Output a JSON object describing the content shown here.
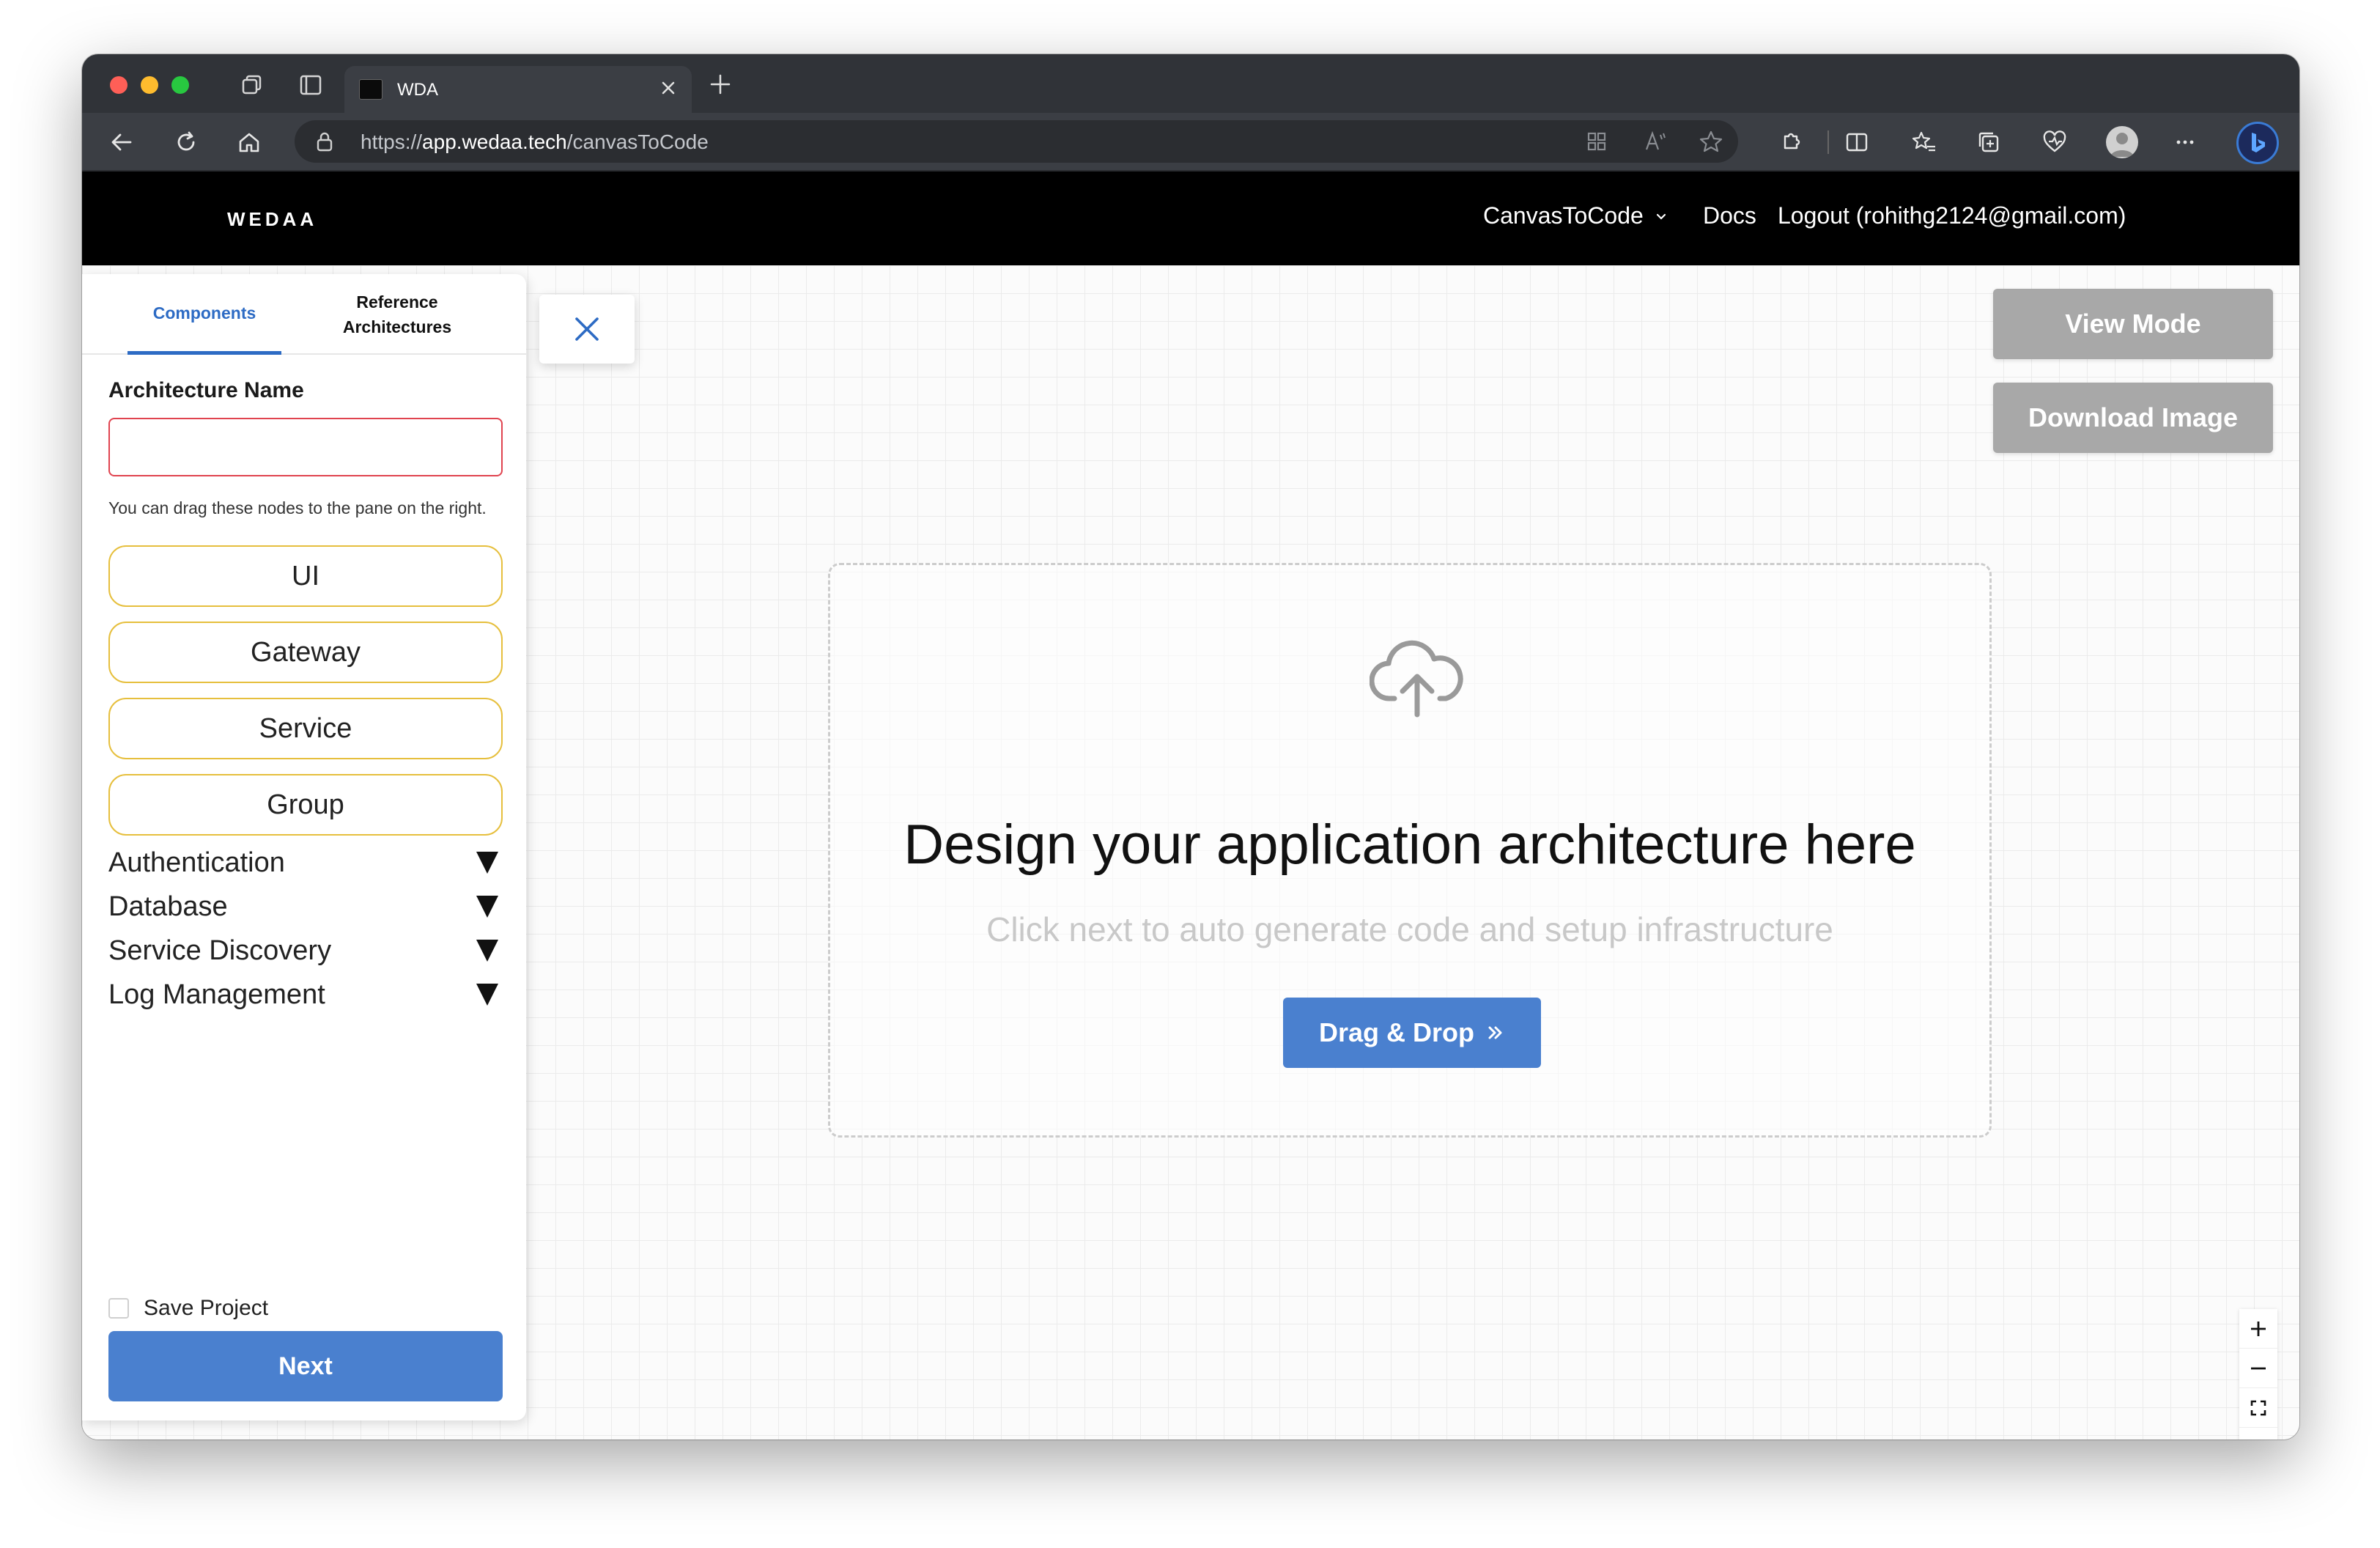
{
  "browser": {
    "tab_title": "WDA",
    "url_scheme": "https://",
    "url_host": "app.wedaa.tech",
    "url_path": "/canvasToCode"
  },
  "header": {
    "logo": "WEDAA",
    "menu_canvas": "CanvasToCode",
    "menu_docs": "Docs",
    "menu_logout": "Logout (rohithg2124@gmail.com)"
  },
  "sidebar": {
    "tab_components": "Components",
    "tab_reference_line1": "Reference",
    "tab_reference_line2": "Architectures",
    "arch_name_label": "Architecture Name",
    "arch_name_value": "",
    "hint": "You can drag these nodes to the pane on the right.",
    "nodes": [
      "UI",
      "Gateway",
      "Service",
      "Group"
    ],
    "categories": [
      "Authentication",
      "Database",
      "Service Discovery",
      "Log Management"
    ],
    "save_project_label": "Save Project",
    "save_project_checked": false,
    "next_label": "Next"
  },
  "canvas": {
    "view_mode_label": "View Mode",
    "download_image_label": "Download Image",
    "drop_title": "Design your application architecture here",
    "drop_subtitle": "Click next to auto generate code and setup infrastructure",
    "drag_drop_label": "Drag & Drop"
  },
  "colors": {
    "primary": "#4a80cf",
    "node_border": "#e6bf3d",
    "input_error": "#e0434f",
    "header_bg": "#000000",
    "grey_button": "#a8a8a8"
  },
  "icons": {
    "upload": "cloud-upload-icon",
    "close": "close-icon",
    "expand": "triangle-down-icon"
  }
}
